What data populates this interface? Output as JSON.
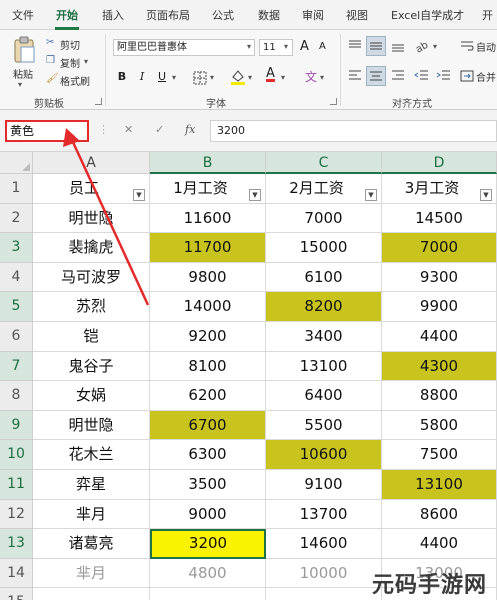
{
  "ribbon_tabs": [
    "文件",
    "开始",
    "插入",
    "页面布局",
    "公式",
    "数据",
    "审阅",
    "视图",
    "Excel自学成才",
    "开"
  ],
  "active_tab": "开始",
  "clipboard": {
    "paste": "粘贴",
    "cut": "剪切",
    "copy": "复制",
    "format_painter": "格式刷",
    "group_label": "剪贴板"
  },
  "font": {
    "name": "阿里巴巴普惠体",
    "size": "11",
    "grow": "A",
    "shrink": "A",
    "bold": "B",
    "italic": "I",
    "underline": "U",
    "wen": "文",
    "color_a": "A",
    "group_label": "字体"
  },
  "alignment": {
    "group_label": "对齐方式",
    "auto_label": "自动",
    "merge_label": "合并"
  },
  "formula_bar": {
    "name_box": "黄色",
    "formula": "3200",
    "fx": "fx",
    "cancel": "✕",
    "enter": "✓"
  },
  "columns": [
    "A",
    "B",
    "C",
    "D"
  ],
  "row_numbers": [
    "1",
    "2",
    "3",
    "4",
    "5",
    "6",
    "7",
    "8",
    "9",
    "10",
    "11",
    "12",
    "13",
    "14",
    "15"
  ],
  "table": {
    "headers": [
      "员工",
      "1月工资",
      "2月工资",
      "3月工资"
    ],
    "rows": [
      [
        "明世隐",
        "11600",
        "7000",
        "14500"
      ],
      [
        "裴擒虎",
        "11700",
        "15000",
        "7000"
      ],
      [
        "马可波罗",
        "9800",
        "6100",
        "9300"
      ],
      [
        "苏烈",
        "14000",
        "8200",
        "9900"
      ],
      [
        "铠",
        "9200",
        "3400",
        "4400"
      ],
      [
        "鬼谷子",
        "8100",
        "13100",
        "4300"
      ],
      [
        "女娲",
        "6200",
        "6400",
        "8800"
      ],
      [
        "明世隐",
        "6700",
        "5500",
        "5800"
      ],
      [
        "花木兰",
        "6300",
        "10600",
        "7500"
      ],
      [
        "弈星",
        "3500",
        "9100",
        "13100"
      ],
      [
        "芈月",
        "9000",
        "13700",
        "8600"
      ],
      [
        "诸葛亮",
        "3200",
        "14600",
        "4400"
      ],
      [
        "芈月",
        "4800",
        "10000",
        "13000"
      ]
    ]
  },
  "highlight_color": "#c9c41d",
  "active_cell_color": "#fbf200",
  "accent_color": "#217346",
  "annotation_color": "#e32b2b",
  "watermark": "元码手游网"
}
